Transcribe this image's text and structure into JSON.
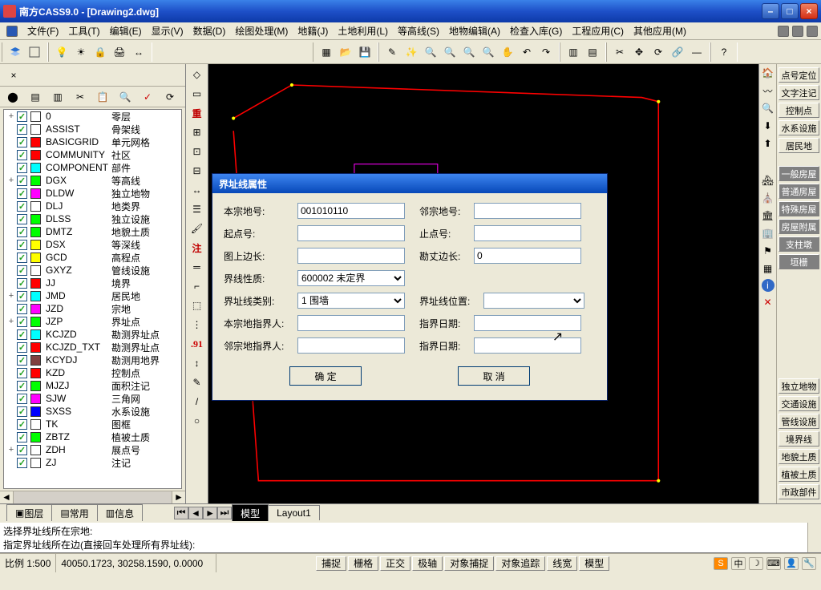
{
  "app": {
    "title": "南方CASS9.0 - [Drawing2.dwg]"
  },
  "menu": [
    "文件(F)",
    "工具(T)",
    "编辑(E)",
    "显示(V)",
    "数据(D)",
    "绘图处理(M)",
    "地籍(J)",
    "土地利用(L)",
    "等高线(S)",
    "地物编辑(A)",
    "检查入库(G)",
    "工程应用(C)",
    "其他应用(M)"
  ],
  "layers": [
    {
      "expand": "+",
      "color": "#ffffff",
      "name": "0",
      "label": "零层"
    },
    {
      "expand": "",
      "color": "#ffffff",
      "name": "ASSIST",
      "label": "骨架线"
    },
    {
      "expand": "",
      "color": "#ff0000",
      "name": "BASICGRID",
      "label": "单元网格"
    },
    {
      "expand": "",
      "color": "#ff0000",
      "name": "COMMUNITY",
      "label": "社区"
    },
    {
      "expand": "",
      "color": "#00ffff",
      "name": "COMPONENT",
      "label": "部件"
    },
    {
      "expand": "+",
      "color": "#00ff00",
      "name": "DGX",
      "label": "等高线"
    },
    {
      "expand": "",
      "color": "#ff00ff",
      "name": "DLDW",
      "label": "独立地物"
    },
    {
      "expand": "",
      "color": "#ffffff",
      "name": "DLJ",
      "label": "地类界"
    },
    {
      "expand": "",
      "color": "#00ff00",
      "name": "DLSS",
      "label": "独立设施"
    },
    {
      "expand": "",
      "color": "#00ff00",
      "name": "DMTZ",
      "label": "地貌土质"
    },
    {
      "expand": "",
      "color": "#ffff00",
      "name": "DSX",
      "label": "等深线"
    },
    {
      "expand": "",
      "color": "#ffff00",
      "name": "GCD",
      "label": "高程点"
    },
    {
      "expand": "",
      "color": "#ffffff",
      "name": "GXYZ",
      "label": "管线设施"
    },
    {
      "expand": "",
      "color": "#ff0000",
      "name": "JJ",
      "label": "境界"
    },
    {
      "expand": "+",
      "color": "#00ffff",
      "name": "JMD",
      "label": "居民地"
    },
    {
      "expand": "",
      "color": "#ff00ff",
      "name": "JZD",
      "label": "宗地"
    },
    {
      "expand": "+",
      "color": "#00ff00",
      "name": "JZP",
      "label": "界址点"
    },
    {
      "expand": "",
      "color": "#00ffff",
      "name": "KCJZD",
      "label": "勘测界址点"
    },
    {
      "expand": "",
      "color": "#ff0000",
      "name": "KCJZD_TXT",
      "label": "勘测界址点"
    },
    {
      "expand": "",
      "color": "#804040",
      "name": "KCYDJ",
      "label": "勘测用地界"
    },
    {
      "expand": "",
      "color": "#ff0000",
      "name": "KZD",
      "label": "控制点"
    },
    {
      "expand": "",
      "color": "#00ff00",
      "name": "MJZJ",
      "label": "面积注记"
    },
    {
      "expand": "",
      "color": "#ff00ff",
      "name": "SJW",
      "label": "三角网"
    },
    {
      "expand": "",
      "color": "#0000ff",
      "name": "SXSS",
      "label": "水系设施"
    },
    {
      "expand": "",
      "color": "#ffffff",
      "name": "TK",
      "label": "图框"
    },
    {
      "expand": "",
      "color": "#00ff00",
      "name": "ZBTZ",
      "label": "植被土质"
    },
    {
      "expand": "+",
      "color": "#ffffff",
      "name": "ZDH",
      "label": "展点号"
    },
    {
      "expand": "",
      "color": "#ffffff",
      "name": "ZJ",
      "label": "注记"
    }
  ],
  "rightButtons1": [
    "点号定位",
    "文字注记",
    "控制点",
    "水系设施",
    "居民地"
  ],
  "rightButtons2": [
    "一般房屋",
    "普通房屋",
    "特殊房屋",
    "房屋附属",
    "支柱墩",
    "垣栅"
  ],
  "rightButtons3": [
    "独立地物",
    "交通设施",
    "管线设施",
    "境界线",
    "地貌土质",
    "植被土质",
    "市政部件"
  ],
  "dialog": {
    "title": "界址线属性",
    "fields": {
      "bzdh_label": "本宗地号:",
      "bzdh_value": "001010110",
      "lzdh_label": "邻宗地号:",
      "lzdh_value": "",
      "qdh_label": "起点号:",
      "qdh_value": "",
      "zdh_label": "止点号:",
      "zdh_value": "",
      "tsbc_label": "图上边长:",
      "tsbc_value": "",
      "kzbc_label": "勘丈边长:",
      "kzbc_value": "0",
      "jxxz_label": "界线性质:",
      "jxxz_value": "600002 未定界",
      "jzxlb_label": "界址线类别:",
      "jzxlb_value": "1 围墙",
      "jzxwz_label": "界址线位置:",
      "jzxwz_value": "",
      "bzdzjr_label": "本宗地指界人:",
      "bzdzjr_value": "",
      "zjrq1_label": "指界日期:",
      "zjrq1_value": "",
      "lzdzjr_label": "邻宗地指界人:",
      "lzdzjr_value": "",
      "zjrq2_label": "指界日期:",
      "zjrq2_value": ""
    },
    "ok": "确  定",
    "cancel": "取  消"
  },
  "bottomTabs": {
    "left": [
      "图层",
      "常用",
      "信息"
    ],
    "mid": [
      "模型",
      "Layout1"
    ]
  },
  "cmd": {
    "line1": "选择界址线所在宗地:",
    "line2": "指定界址线所在边(直接回车处理所有界址线):"
  },
  "status": {
    "scale": "比例 1:500",
    "coords": "40050.1723, 30258.1590, 0.0000",
    "toggles": [
      "捕捉",
      "栅格",
      "正交",
      "极轴",
      "对象捕捉",
      "对象追踪",
      "线宽",
      "模型"
    ],
    "tray_cn": "中"
  }
}
